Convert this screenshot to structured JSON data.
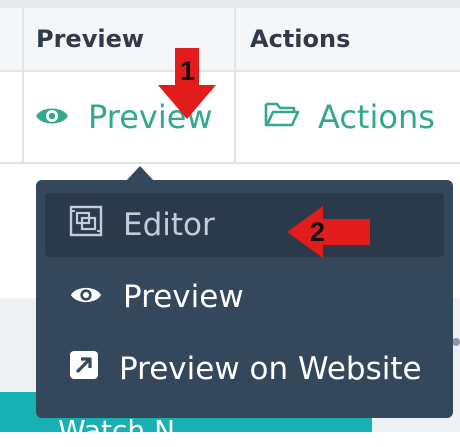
{
  "table": {
    "headers": [
      "Preview",
      "Actions"
    ],
    "cells": {
      "preview_label": "Preview",
      "actions_label": "Actions"
    }
  },
  "dropdown": {
    "items": [
      {
        "label": "Editor",
        "icon": "editor-icon",
        "active": true
      },
      {
        "label": "Preview",
        "icon": "eye-icon"
      },
      {
        "label": "Preview on Website",
        "icon": "external-link-icon"
      }
    ]
  },
  "background": {
    "partial_text": "Watch N"
  },
  "annotations": {
    "step1": "1",
    "step2": "2"
  },
  "colors": {
    "accent": "#34a88c",
    "menu_bg": "#34475b",
    "annotation_arrow": "#e21b1b"
  }
}
